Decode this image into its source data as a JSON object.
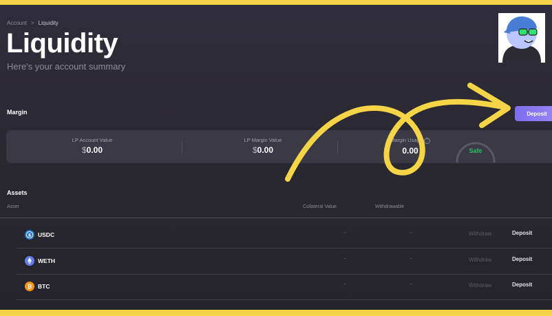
{
  "breadcrumb": {
    "parent": "Account",
    "separator": ">",
    "current": "Liquidity"
  },
  "page": {
    "title": "Liquidity",
    "subtitle": "Here's your account summary"
  },
  "margin": {
    "section_title": "Margin",
    "deposit_label": "Deposit",
    "stats": [
      {
        "label": "LP Account Value",
        "currency": "$",
        "value": "0.00"
      },
      {
        "label": "LP Margin Value",
        "currency": "$",
        "value": "0.00"
      },
      {
        "label": "Margin Usage",
        "value": "0.00"
      }
    ],
    "health": {
      "status": "Safe",
      "color": "#22c55e",
      "level": 0
    }
  },
  "assets": {
    "section_title": "Assets",
    "columns": {
      "asset": "Asset",
      "collateral": "Collateral Value",
      "withdrawable": "Withdrawable"
    },
    "rows": [
      {
        "symbol": "USDC",
        "icon": "usdc-icon",
        "color": "#2775ca",
        "collateral": "-",
        "withdrawable": "-",
        "withdraw_label": "Withdraw",
        "deposit_label": "Deposit"
      },
      {
        "symbol": "WETH",
        "icon": "eth-icon",
        "color": "#627eea",
        "collateral": "-",
        "withdrawable": "-",
        "withdraw_label": "Withdraw",
        "deposit_label": "Deposit"
      },
      {
        "symbol": "BTC",
        "icon": "btc-icon",
        "color": "#f7931a",
        "collateral": "-",
        "withdrawable": "-",
        "withdraw_label": "Withdraw",
        "deposit_label": "Deposit"
      }
    ]
  },
  "theme": {
    "accent": "#8b7af2",
    "frame": "#f5d547",
    "annotation": "#f5d547"
  }
}
